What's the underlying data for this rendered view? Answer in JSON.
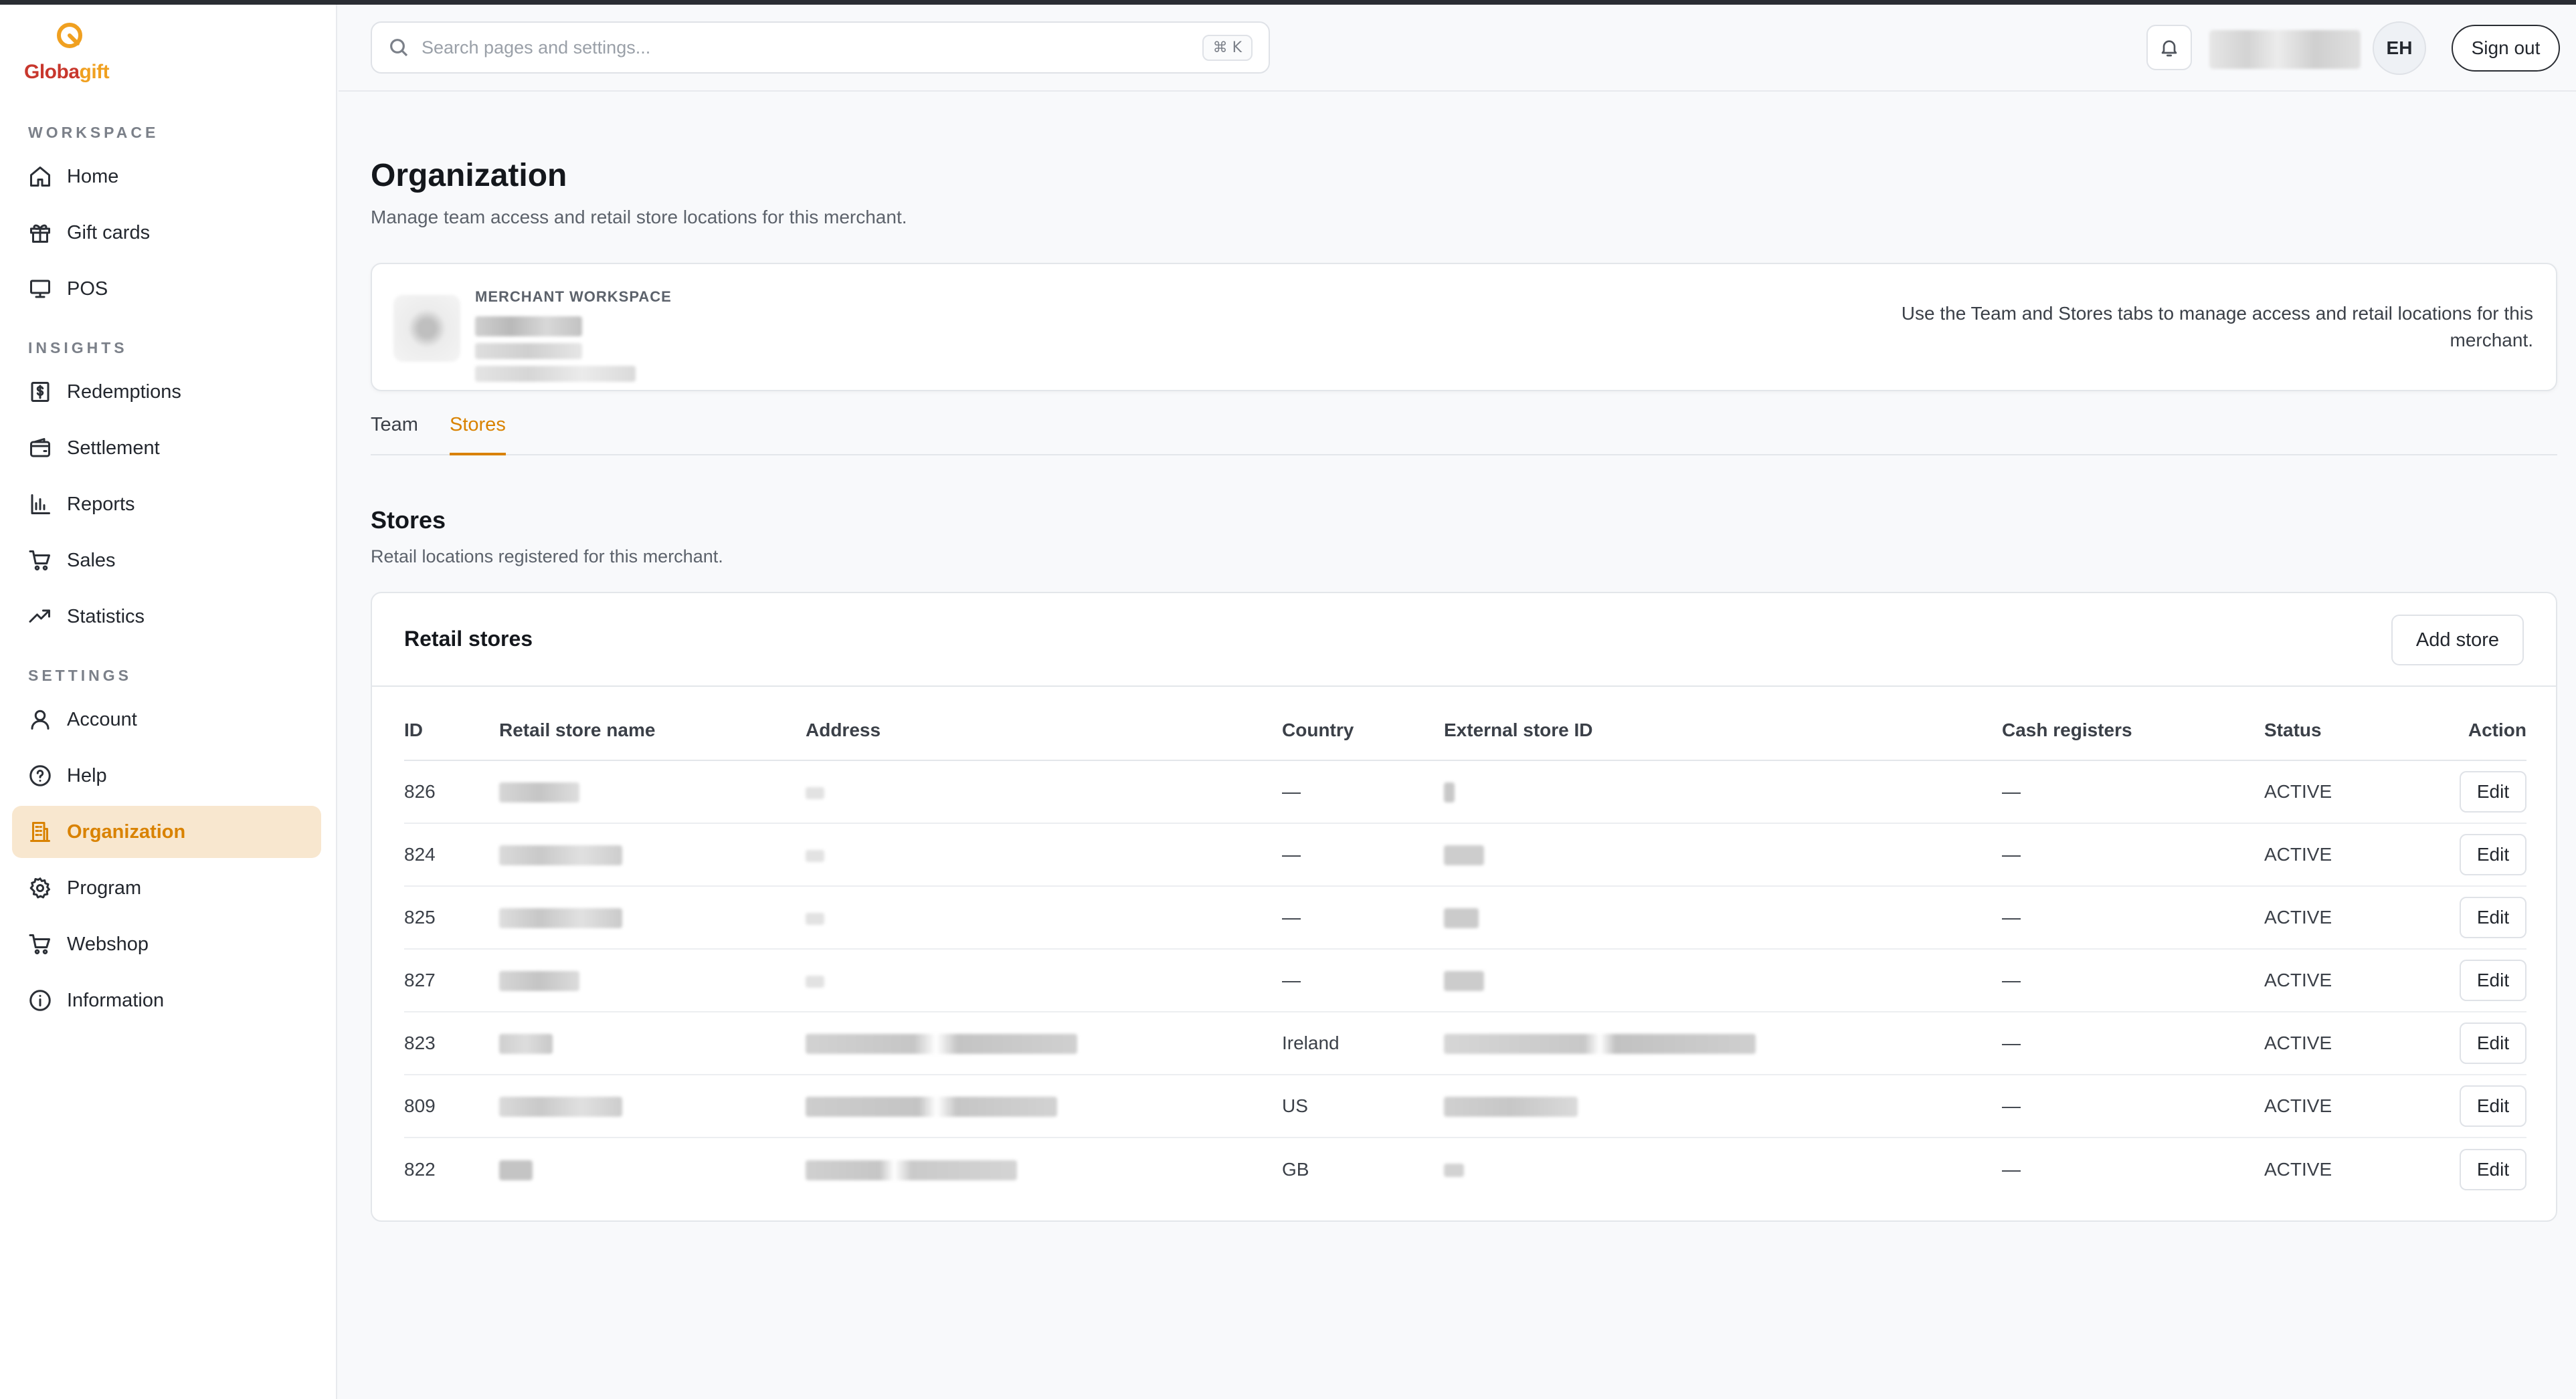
{
  "brand": {
    "logo_part1": "Globa",
    "logo_part2": "gift",
    "accent": "#d98200",
    "logo_red": "#c8372d",
    "logo_orange": "#f0a020"
  },
  "sidebar": {
    "sections": {
      "workspace": "WORKSPACE",
      "insights": "INSIGHTS",
      "settings": "SETTINGS"
    },
    "items": [
      {
        "label": "Home",
        "icon": "home-icon"
      },
      {
        "label": "Gift cards",
        "icon": "gift-icon"
      },
      {
        "label": "POS",
        "icon": "monitor-icon"
      },
      {
        "label": "Redemptions",
        "icon": "dollar-receipt-icon"
      },
      {
        "label": "Settlement",
        "icon": "wallet-icon"
      },
      {
        "label": "Reports",
        "icon": "bar-chart-icon"
      },
      {
        "label": "Sales",
        "icon": "cart-icon"
      },
      {
        "label": "Statistics",
        "icon": "trending-up-icon"
      },
      {
        "label": "Account",
        "icon": "user-icon"
      },
      {
        "label": "Help",
        "icon": "help-circle-icon"
      },
      {
        "label": "Organization",
        "icon": "building-icon",
        "active": true
      },
      {
        "label": "Program",
        "icon": "gear-icon"
      },
      {
        "label": "Webshop",
        "icon": "cart-icon"
      },
      {
        "label": "Information",
        "icon": "info-icon"
      }
    ]
  },
  "header": {
    "search_placeholder": "Search pages and settings...",
    "search_shortcut": "⌘ K",
    "avatar_initials": "EH",
    "sign_out": "Sign out"
  },
  "page": {
    "title": "Organization",
    "subtitle": "Manage team access and retail store locations for this merchant."
  },
  "merchant": {
    "label": "MERCHANT WORKSPACE",
    "note": "Use the Team and Stores tabs to manage access and retail locations for this merchant."
  },
  "tabs": [
    {
      "label": "Team",
      "active": false
    },
    {
      "label": "Stores",
      "active": true
    }
  ],
  "stores": {
    "title": "Stores",
    "subtitle": "Retail locations registered for this merchant.",
    "card_title": "Retail stores",
    "add_button": "Add store",
    "columns": [
      "ID",
      "Retail store name",
      "Address",
      "Country",
      "External store ID",
      "Cash registers",
      "Status",
      "Action"
    ],
    "rows": [
      {
        "id": "826",
        "country": "—",
        "cash_registers": "—",
        "status": "ACTIVE",
        "action": "Edit"
      },
      {
        "id": "824",
        "country": "—",
        "cash_registers": "—",
        "status": "ACTIVE",
        "action": "Edit"
      },
      {
        "id": "825",
        "country": "—",
        "cash_registers": "—",
        "status": "ACTIVE",
        "action": "Edit"
      },
      {
        "id": "827",
        "country": "—",
        "cash_registers": "—",
        "status": "ACTIVE",
        "action": "Edit"
      },
      {
        "id": "823",
        "country": "Ireland",
        "cash_registers": "—",
        "status": "ACTIVE",
        "action": "Edit"
      },
      {
        "id": "809",
        "country": "US",
        "cash_registers": "—",
        "status": "ACTIVE",
        "action": "Edit"
      },
      {
        "id": "822",
        "country": "GB",
        "cash_registers": "—",
        "status": "ACTIVE",
        "action": "Edit"
      }
    ]
  }
}
